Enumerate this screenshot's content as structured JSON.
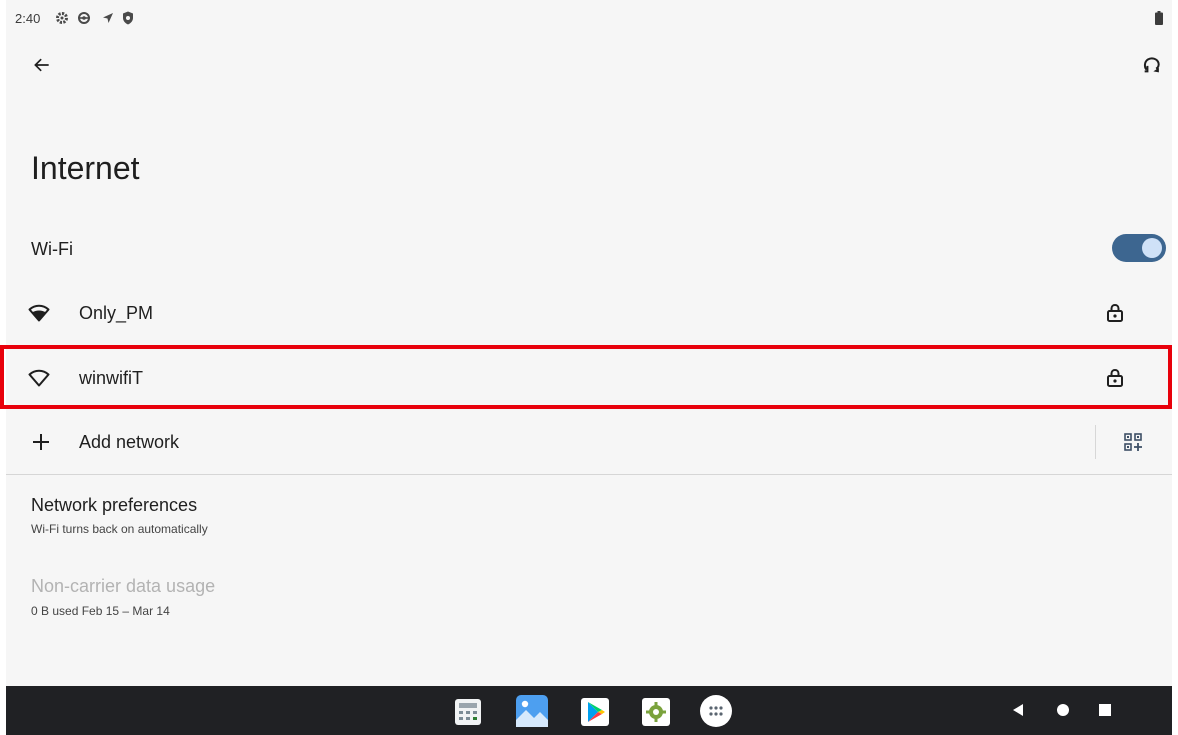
{
  "status_bar": {
    "time": "2:40",
    "icons": [
      "settings-gear-icon",
      "settings-gear-alt-icon",
      "location-arrow-icon",
      "shield-icon"
    ],
    "battery": "battery-icon"
  },
  "app_bar": {
    "back_icon": "arrow-back-icon",
    "help_icon": "help-feedback-icon"
  },
  "page": {
    "title": "Internet"
  },
  "wifi": {
    "label": "Wi-Fi",
    "enabled": true
  },
  "networks": [
    {
      "ssid": "Only_PM",
      "secured": true,
      "signal_icon": "wifi-signal-full-icon",
      "lock_icon": "lock-icon"
    },
    {
      "ssid": "winwifiT",
      "secured": true,
      "signal_icon": "wifi-signal-weak-icon",
      "lock_icon": "lock-icon",
      "highlighted": true
    }
  ],
  "add_network": {
    "label": "Add network",
    "plus_icon": "plus-icon",
    "qr_icon": "qr-code-scan-icon"
  },
  "network_preferences": {
    "title": "Network preferences",
    "subtitle": "Wi-Fi turns back on automatically"
  },
  "data_usage": {
    "title": "Non-carrier data usage",
    "subtitle": "0 B used Feb 15 – Mar 14"
  },
  "dock": {
    "apps": [
      "calculator-app-icon",
      "gallery-app-icon",
      "play-store-app-icon",
      "dev-tools-app-icon",
      "app-drawer-icon"
    ]
  },
  "nav_keys": [
    "nav-back-icon",
    "nav-home-icon",
    "nav-recents-icon"
  ],
  "colors": {
    "accent": "#3d6690",
    "toggle_thumb": "#cfe1f7",
    "highlight": "#e8000b",
    "nav_bar": "#202124",
    "background": "#f6f6f6"
  }
}
